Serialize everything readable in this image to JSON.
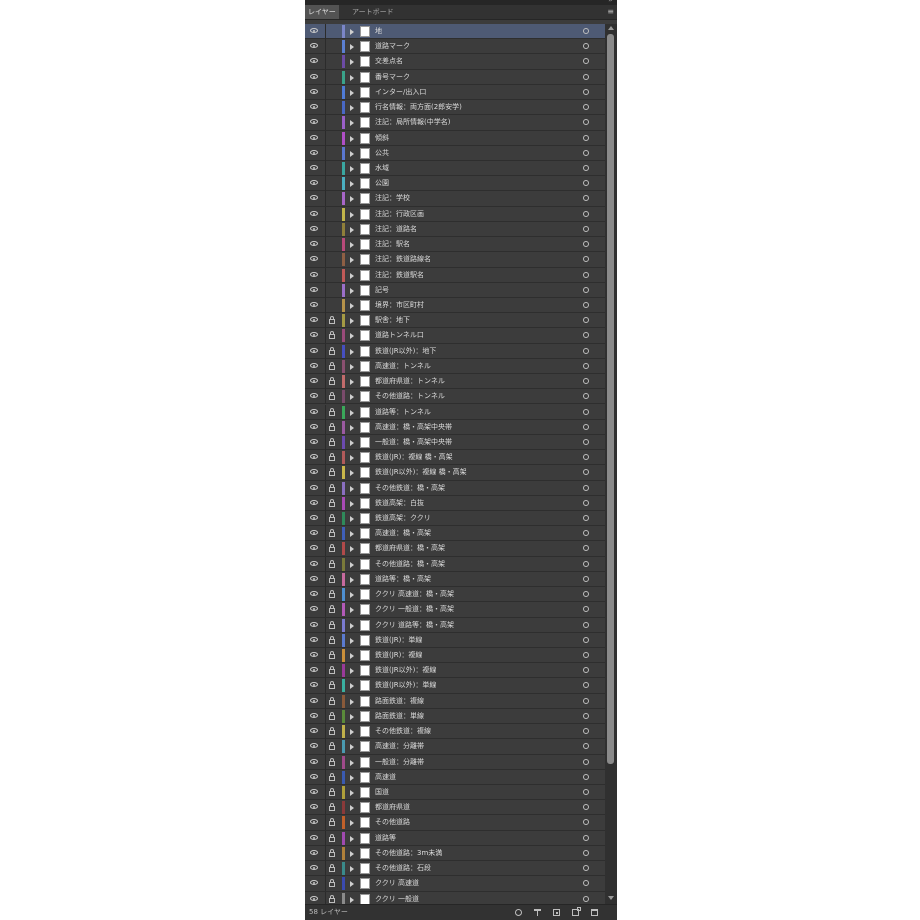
{
  "panel": {
    "tabs": [
      {
        "label": "レイヤー",
        "active": true
      },
      {
        "label": "アートボード",
        "active": false
      }
    ],
    "collapse_glyph": "»",
    "menu_glyph": "≡"
  },
  "layers": [
    {
      "name": "地",
      "color": "#7b86c9",
      "locked": false,
      "selected": true
    },
    {
      "name": "道路マーク",
      "color": "#5b7fd1",
      "locked": false
    },
    {
      "name": "交差点名",
      "color": "#6c4ba6",
      "locked": false
    },
    {
      "name": "番号マーク",
      "color": "#3aa38a",
      "locked": false
    },
    {
      "name": "インター/出入口",
      "color": "#4f7bd6",
      "locked": false
    },
    {
      "name": "行名情報：両方面(2郎安学)",
      "color": "#4968c4",
      "locked": false
    },
    {
      "name": "注記：局所情報(中学名)",
      "color": "#9b5fc9",
      "locked": false
    },
    {
      "name": "傾斜",
      "color": "#b04fc7",
      "locked": false
    },
    {
      "name": "公共",
      "color": "#5a77d0",
      "locked": false
    },
    {
      "name": "水域",
      "color": "#3aa7a0",
      "locked": false
    },
    {
      "name": "公園",
      "color": "#4bb0c1",
      "locked": false
    },
    {
      "name": "注記：学校",
      "color": "#a866c8",
      "locked": false
    },
    {
      "name": "注記：行政区画",
      "color": "#c2b54a",
      "locked": false
    },
    {
      "name": "注記：道路名",
      "color": "#8f7f3a",
      "locked": false
    },
    {
      "name": "注記：駅名",
      "color": "#b84a7a",
      "locked": false
    },
    {
      "name": "注記：鉄道路線名",
      "color": "#8e5f44",
      "locked": false
    },
    {
      "name": "注記：鉄道駅名",
      "color": "#c05a58",
      "locked": false
    },
    {
      "name": "記号",
      "color": "#9b6fc9",
      "locked": false
    },
    {
      "name": "境界：市区町村",
      "color": "#b5924a",
      "locked": false
    },
    {
      "name": "駅舎：地下",
      "color": "#a59a44",
      "locked": true
    },
    {
      "name": "道路トンネル口",
      "color": "#9a4b7a",
      "locked": true
    },
    {
      "name": "鉄道(JR以外)：地下",
      "color": "#464fc0",
      "locked": true
    },
    {
      "name": "高速道：トンネル",
      "color": "#8a5070",
      "locked": true
    },
    {
      "name": "都道府県道：トンネル",
      "color": "#c26b6b",
      "locked": true
    },
    {
      "name": "その他道路：トンネル",
      "color": "#7a4b6b",
      "locked": true
    },
    {
      "name": "道路等：トンネル",
      "color": "#3aa85a",
      "locked": true
    },
    {
      "name": "高速道：橋・高架中央帯",
      "color": "#9a5aa0",
      "locked": true
    },
    {
      "name": "一般道：橋・高架中央帯",
      "color": "#6b4ab0",
      "locked": true
    },
    {
      "name": "鉄道(JR)：複線 橋・高架",
      "color": "#b05a5a",
      "locked": true
    },
    {
      "name": "鉄道(JR以外)：複線 橋・高架",
      "color": "#c9b74a",
      "locked": true
    },
    {
      "name": "その他鉄道：橋・高架",
      "color": "#8a6fc0",
      "locked": true
    },
    {
      "name": "鉄道高架：白抜",
      "color": "#a84ab5",
      "locked": true
    },
    {
      "name": "鉄道高架：ククリ",
      "color": "#2f8a5a",
      "locked": true
    },
    {
      "name": "高速道：橋・高架",
      "color": "#3f5fb9",
      "locked": true
    },
    {
      "name": "都道府県道：橋・高架",
      "color": "#b14a4a",
      "locked": true
    },
    {
      "name": "その他道路：橋・高架",
      "color": "#7a7a3a",
      "locked": true
    },
    {
      "name": "道路等：橋・高架",
      "color": "#c76a9e",
      "locked": true
    },
    {
      "name": "ククリ 高速道：橋・高架",
      "color": "#4e8fd0",
      "locked": true
    },
    {
      "name": "ククリ 一般道：橋・高架",
      "color": "#b35ab8",
      "locked": true
    },
    {
      "name": "ククリ 道路等：橋・高架",
      "color": "#7b7bd0",
      "locked": true
    },
    {
      "name": "鉄道(JR)：単線",
      "color": "#5b7bd0",
      "locked": true
    },
    {
      "name": "鉄道(JR)：複線",
      "color": "#c98f3a",
      "locked": true
    },
    {
      "name": "鉄道(JR以外)：複線",
      "color": "#9a3a9a",
      "locked": true
    },
    {
      "name": "鉄道(JR以外)：単線",
      "color": "#3ab0a0",
      "locked": true
    },
    {
      "name": "路面鉄道：複線",
      "color": "#8a5a3a",
      "locked": true
    },
    {
      "name": "路面鉄道：単線",
      "color": "#5a8a3a",
      "locked": true
    },
    {
      "name": "その他鉄道：複線",
      "color": "#c0b04a",
      "locked": true
    },
    {
      "name": "高速道：分離帯",
      "color": "#4a9ab0",
      "locked": true
    },
    {
      "name": "一般道：分離帯",
      "color": "#a04a8a",
      "locked": true
    },
    {
      "name": "高速道",
      "color": "#3a5ab0",
      "locked": true
    },
    {
      "name": "国道",
      "color": "#b0a03a",
      "locked": true
    },
    {
      "name": "都道府県道",
      "color": "#8a3a3a",
      "locked": true
    },
    {
      "name": "その他道路",
      "color": "#c0602a",
      "locked": true
    },
    {
      "name": "道路等",
      "color": "#a04ab0",
      "locked": true
    },
    {
      "name": "その他道路：3m未満",
      "color": "#b0803a",
      "locked": true
    },
    {
      "name": "その他道路：石段",
      "color": "#3a8a8a",
      "locked": true
    },
    {
      "name": "ククリ 高速道",
      "color": "#3a4ab0",
      "locked": true
    },
    {
      "name": "ククリ 一般道",
      "color": "#8a8a8a",
      "locked": true
    }
  ],
  "footer": {
    "layer_count": "58 レイヤー"
  }
}
